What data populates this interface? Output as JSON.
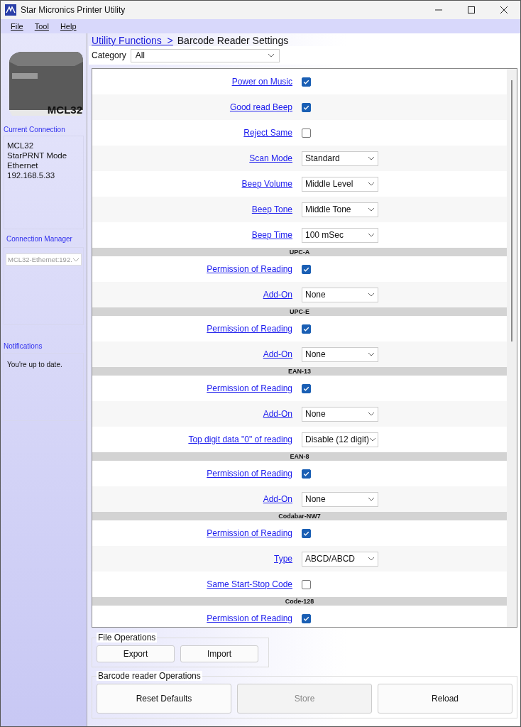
{
  "window": {
    "title": "Star Micronics  Printer Utility"
  },
  "menu": [
    "File",
    "Tool",
    "Help"
  ],
  "sidebar": {
    "model_label": "MCL32",
    "current_connection": {
      "title": "Current Connection",
      "lines": [
        "MCL32",
        "StarPRNT Mode",
        "Ethernet",
        "192.168.5.33"
      ]
    },
    "connection_manager": {
      "title": "Connection Manager",
      "value": "MCL32-Ethernet:192."
    },
    "notifications": {
      "title": "Notifications",
      "text": "You're up to date."
    }
  },
  "breadcrumb": {
    "link": "Utility Functions  >",
    "current": "Barcode Reader Settings"
  },
  "category": {
    "label": "Category",
    "value": "All"
  },
  "settings": [
    {
      "kind": "checkbox",
      "label": "Power on Music",
      "checked": true
    },
    {
      "kind": "checkbox",
      "label": "Good read Beep",
      "checked": true
    },
    {
      "kind": "checkbox",
      "label": "Reject Same",
      "checked": false
    },
    {
      "kind": "select",
      "label": "Scan Mode",
      "value": "Standard"
    },
    {
      "kind": "select",
      "label": "Beep Volume",
      "value": "Middle Level"
    },
    {
      "kind": "select",
      "label": "Beep Tone",
      "value": "Middle Tone"
    },
    {
      "kind": "select",
      "label": "Beep Time",
      "value": "100 mSec"
    },
    {
      "kind": "section",
      "label": "UPC-A"
    },
    {
      "kind": "checkbox",
      "label": "Permission of Reading",
      "checked": true
    },
    {
      "kind": "select",
      "label": "Add-On",
      "value": "None"
    },
    {
      "kind": "section",
      "label": "UPC-E"
    },
    {
      "kind": "checkbox",
      "label": "Permission of Reading",
      "checked": true
    },
    {
      "kind": "select",
      "label": "Add-On",
      "value": "None"
    },
    {
      "kind": "section",
      "label": "EAN-13"
    },
    {
      "kind": "checkbox",
      "label": "Permission of Reading",
      "checked": true
    },
    {
      "kind": "select",
      "label": "Add-On",
      "value": "None"
    },
    {
      "kind": "select",
      "label": "Top digit data \"0\" of reading",
      "value": "Disable (12 digit)"
    },
    {
      "kind": "section",
      "label": "EAN-8"
    },
    {
      "kind": "checkbox",
      "label": "Permission of Reading",
      "checked": true
    },
    {
      "kind": "select",
      "label": "Add-On",
      "value": "None"
    },
    {
      "kind": "section",
      "label": "Codabar-NW7"
    },
    {
      "kind": "checkbox",
      "label": "Permission of Reading",
      "checked": true
    },
    {
      "kind": "select",
      "label": "Type",
      "value": "ABCD/ABCD"
    },
    {
      "kind": "checkbox",
      "label": "Same Start-Stop Code",
      "checked": false
    },
    {
      "kind": "section",
      "label": "Code-128"
    },
    {
      "kind": "checkbox",
      "label": "Permission of Reading",
      "checked": true
    }
  ],
  "file_operations": {
    "title": "File Operations",
    "buttons": [
      {
        "label": "Export",
        "disabled": false
      },
      {
        "label": "Import",
        "disabled": false
      }
    ]
  },
  "reader_operations": {
    "title": "Barcode reader Operations",
    "buttons": [
      {
        "label": "Reset Defaults",
        "disabled": false
      },
      {
        "label": "Store",
        "disabled": true
      },
      {
        "label": "Reload",
        "disabled": false
      }
    ]
  }
}
